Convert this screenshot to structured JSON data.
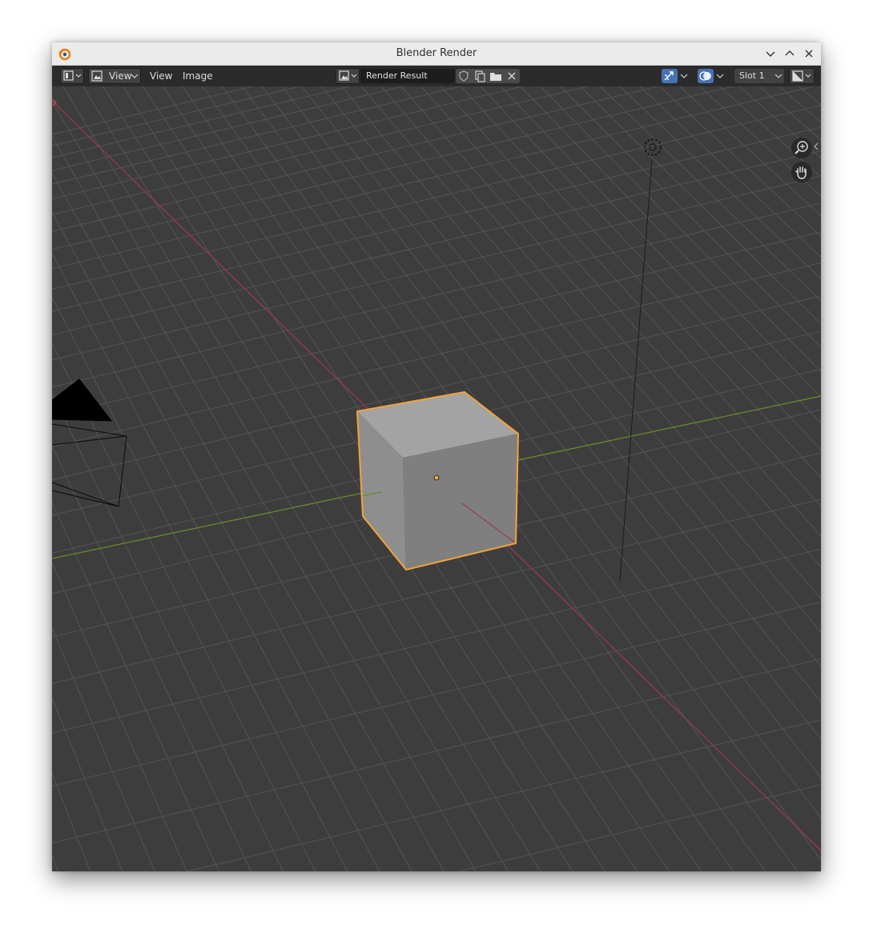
{
  "window": {
    "title": "Blender Render"
  },
  "toolbar": {
    "view_dropdown_label": "View",
    "menu_view": "View",
    "menu_image": "Image",
    "image_name": "Render Result",
    "slot_label": "Slot 1"
  },
  "colors": {
    "viewport_bg": "#3d3d3d",
    "grid": "#555555",
    "x_axis": "#9b3a4a",
    "y_axis": "#6a8a2c",
    "selection_outline": "#f2a33a",
    "active_blue": "#4772b3"
  },
  "icons": {
    "app": "blender-logo-icon",
    "editor_type": "image-editor-icon",
    "fake_user": "shield-icon",
    "new_image": "new-image-icon",
    "open_image": "folder-icon",
    "unlink": "close-icon",
    "gizmo": "gizmo-icon",
    "overlay": "overlay-icon",
    "display_channels": "display-channels-icon",
    "zoom": "zoom-icon",
    "pan": "hand-icon",
    "light": "light-icon"
  }
}
